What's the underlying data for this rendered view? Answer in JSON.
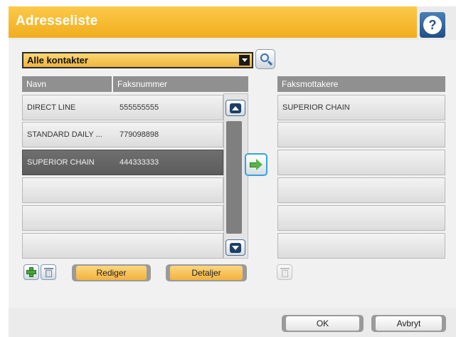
{
  "title": "Adresseliste",
  "help_icon_glyph": "?",
  "contacts_filter": {
    "selected": "Alle kontakter"
  },
  "table": {
    "headers": [
      "Navn",
      "Faksnummer"
    ],
    "rows": [
      {
        "name": "DIRECT LINE",
        "fax": "555555555",
        "selected": false
      },
      {
        "name": "STANDARD DAILY ...",
        "fax": "779098898",
        "selected": false
      },
      {
        "name": "SUPERIOR CHAIN",
        "fax": "444333333",
        "selected": true
      },
      {
        "name": "",
        "fax": "",
        "selected": false
      },
      {
        "name": "",
        "fax": "",
        "selected": false
      },
      {
        "name": "",
        "fax": "",
        "selected": false
      }
    ]
  },
  "recipients": {
    "header": "Faksmottakere",
    "rows": [
      "SUPERIOR CHAIN",
      "",
      "",
      "",
      "",
      ""
    ]
  },
  "buttons": {
    "edit": "Rediger",
    "details": "Detaljer",
    "ok": "OK",
    "cancel": "Avbryt"
  },
  "colors": {
    "title_bar": "#f2ad1e",
    "help_button": "#1f4f86",
    "selected_row": "#666666",
    "add_arrow": "#58b447",
    "highlight_border": "#34a3d8"
  }
}
